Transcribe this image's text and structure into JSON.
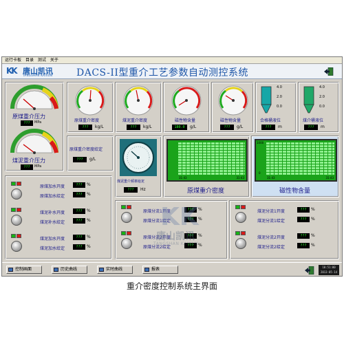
{
  "menubar": {
    "items": [
      "运行卡板",
      "目录",
      "测试",
      "关于"
    ]
  },
  "header": {
    "logo_cn": "唐山凯讯",
    "logo_en": "TANGSHAN KAIXUN",
    "title": "DACS-II型重介工艺参数自动测控系统"
  },
  "gauges": {
    "raw_pressure": {
      "label": "原煤重介压力",
      "value": "???",
      "unit": "MPa"
    },
    "slime_pressure": {
      "label": "煤泥重介压力",
      "value": "???",
      "unit": "MPa"
    },
    "raw_density": {
      "label": "原煤重介密度",
      "value": "???",
      "unit": "kg/L"
    },
    "slime_density": {
      "label": "煤泥重介密度",
      "value": "???",
      "unit": "kg/L"
    },
    "magnetic": {
      "label": "磁性物含量",
      "value": "180.0",
      "unit": "g/L"
    },
    "magnetic2": {
      "label": "磁性物含量",
      "value": "???",
      "unit": "g/L"
    },
    "tank_level": {
      "label": "合格桶液位",
      "value": "???",
      "unit": "m"
    },
    "slime_tank": {
      "label": "煤介桶液位",
      "value": "???",
      "unit": "m"
    },
    "density_setpoint": {
      "label": "原煤重介密度给定",
      "value": "???",
      "unit": "g/L"
    },
    "freq_setpoint": {
      "label": "煤泥重介频率给定",
      "value": "???",
      "unit": "Hz"
    }
  },
  "tank_scale": {
    "top": "4.0",
    "mid": "2.0",
    "bottom": "0.0"
  },
  "left_controls": [
    {
      "label_a": "原煤加水开度",
      "value_a": "???",
      "unit_a": "%",
      "label_b": "原煤加水给定",
      "value_b": "???",
      "unit_b": "%"
    },
    {
      "label_a": "煤泥补水开度",
      "value_a": "???",
      "unit_a": "%",
      "label_b": "煤泥补水给定",
      "value_b": "???",
      "unit_b": "%"
    },
    {
      "label_a": "煤泥加水开度",
      "value_a": "???",
      "unit_a": "%",
      "label_b": "煤泥加水给定",
      "value_b": "???",
      "unit_b": "%"
    }
  ],
  "mid_controls": [
    {
      "label_a": "原煤分流1开度",
      "value_a": "???",
      "unit_a": "%",
      "label_b": "原煤分流1给定",
      "value_b": "???",
      "unit_b": "%"
    },
    {
      "label_a": "原煤分流2开度",
      "value_a": "???",
      "unit_a": "%",
      "label_b": "原煤分流2给定",
      "value_b": "???",
      "unit_b": "%"
    }
  ],
  "right_controls": [
    {
      "label_a": "煤泥分流1开度",
      "value_a": "???",
      "unit_a": "%",
      "label_b": "煤泥分流1给定",
      "value_b": "???",
      "unit_b": "%"
    },
    {
      "label_a": "煤泥分流2开度",
      "value_a": "???",
      "unit_a": "%",
      "label_b": "煤泥分流2给定",
      "value_b": "???",
      "unit_b": "%"
    }
  ],
  "trends": {
    "left": {
      "title": "原煤重介密度",
      "y_top": "",
      "y_bottom": "",
      "t_start": "31:43",
      "t_end": "31:43"
    },
    "right": {
      "title": "磁性物含量",
      "y_top": "1000",
      "y_bottom": "0",
      "t_start": "31:43",
      "t_end": "31:43"
    }
  },
  "nav": [
    "控制画面",
    "历史曲线",
    "实时曲线",
    "报表"
  ],
  "clock": {
    "time": "10:51:00",
    "date": "2013-05-14"
  },
  "watermark": {
    "cn": "唐山凯讯",
    "en": "TANGSHAN KAIXUN"
  },
  "caption": "重介密度控制系统主界面",
  "colors": {
    "title_blue": "#1e56a8",
    "value_green": "#2bff2b",
    "trend_green": "#1aa31a",
    "panel_gray": "#d4d0c8"
  }
}
